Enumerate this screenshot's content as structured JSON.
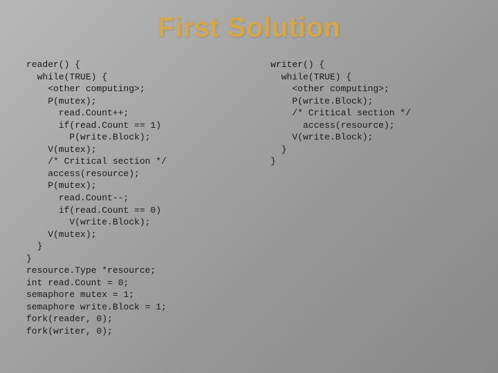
{
  "title": "First Solution",
  "reader_code": "reader() {\n  while(TRUE) {\n    <other computing>;\n    P(mutex);\n      read.Count++;\n      if(read.Count == 1)\n        P(write.Block);\n    V(mutex);\n    /* Critical section */\n    access(resource);\n    P(mutex);\n      read.Count--;\n      if(read.Count == 0)\n        V(write.Block);\n    V(mutex);\n  }\n}\nresource.Type *resource;\nint read.Count = 0;\nsemaphore mutex = 1;\nsemaphore write.Block = 1;\nfork(reader, 0);\nfork(writer, 0);",
  "writer_code": "writer() {\n  while(TRUE) {\n    <other computing>;\n    P(write.Block);\n    /* Critical section */\n      access(resource);\n    V(write.Block);\n  }\n}"
}
